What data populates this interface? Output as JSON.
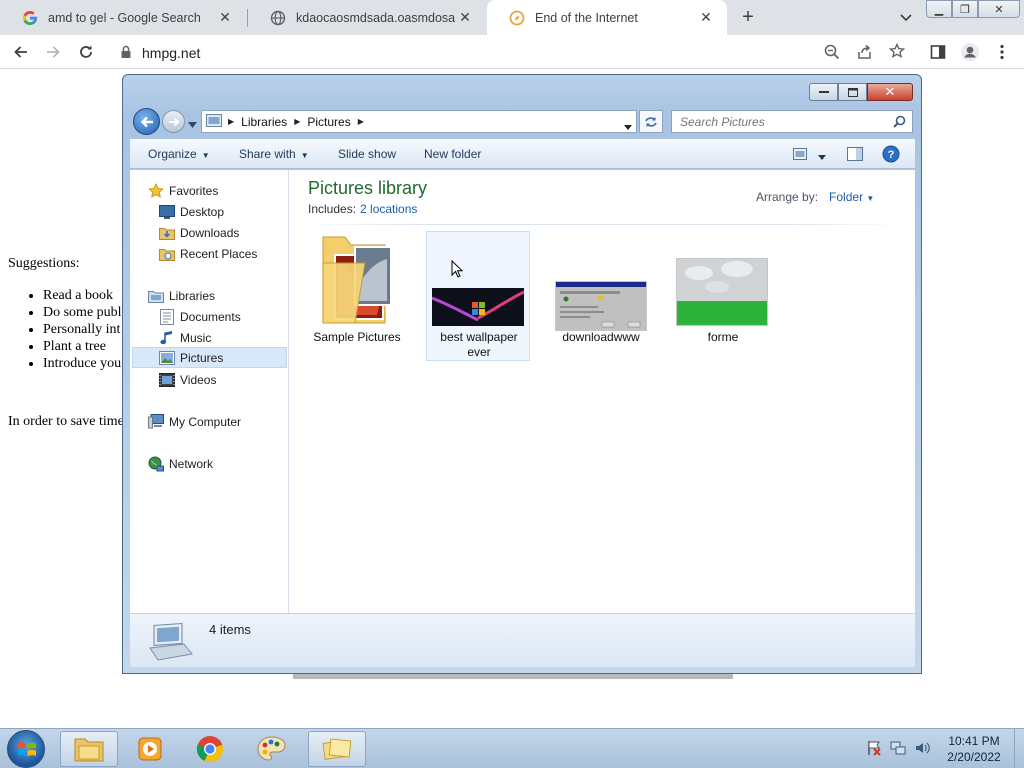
{
  "browser": {
    "tabs": [
      {
        "title": "amd to gel - Google Search",
        "icon": "google-icon"
      },
      {
        "title": "kdaocaosmdsada.oasmdosamd.c",
        "icon": "globe-icon"
      },
      {
        "title": "End of the Internet",
        "icon": "compass-icon",
        "active": true
      }
    ],
    "new_tab_label": "+",
    "url": "hmpg.net"
  },
  "page": {
    "suggestions_label": "Suggestions:",
    "suggestions": [
      "Read a book",
      "Do some publ",
      "Personally int",
      "Plant a tree",
      "Introduce you"
    ],
    "save_text": "In order to save time"
  },
  "explorer": {
    "breadcrumb": [
      "Libraries",
      "Pictures"
    ],
    "search_placeholder": "Search Pictures",
    "commands": {
      "organize": "Organize",
      "share_with": "Share with",
      "slide_show": "Slide show",
      "new_folder": "New folder"
    },
    "nav": {
      "favorites": "Favorites",
      "desktop": "Desktop",
      "downloads": "Downloads",
      "recent_places": "Recent Places",
      "libraries": "Libraries",
      "documents": "Documents",
      "music": "Music",
      "pictures": "Pictures",
      "videos": "Videos",
      "my_computer": "My Computer",
      "network": "Network"
    },
    "library_title": "Pictures library",
    "includes_label": "Includes:",
    "includes_link": "2 locations",
    "arrange_label": "Arrange by:",
    "arrange_value": "Folder",
    "items": {
      "sample": "Sample Pictures",
      "wallpaper_line1": "best wallpaper",
      "wallpaper_line2": "ever",
      "download": "downloadwww",
      "forme": "forme"
    },
    "item_count": "4 items"
  },
  "taskbar": {
    "time": "10:41 PM",
    "date": "2/20/2022"
  },
  "colors": {
    "library_title": "#1e6b2f",
    "link": "#1a5cb0",
    "selection": "#d9e8f8"
  }
}
